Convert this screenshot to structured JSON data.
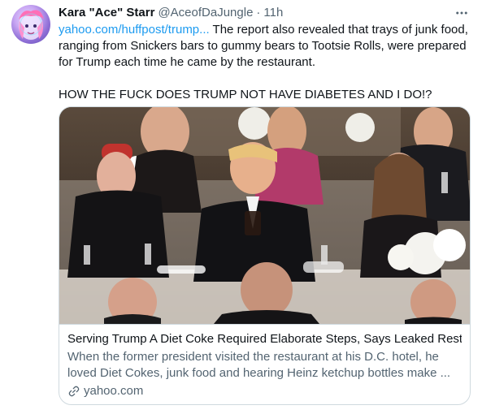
{
  "tweet": {
    "display_name": "Kara \"Ace\" Starr",
    "handle": "@AceofDaJungle",
    "separator": "·",
    "time": "11h",
    "link_text": "yahoo.com/huffpost/trump...",
    "text_after_link": " The report also revealed that trays of junk food, ranging from Snickers bars to gummy bears to Tootsie Rolls, were prepared for Trump each time he came by the restaurant.",
    "second_paragraph": "HOW THE FUCK DOES TRUMP NOT HAVE DIABETES AND I DO!?"
  },
  "icons": {
    "more": "more-horizontal-icon",
    "link": "link-icon"
  },
  "card": {
    "title": "Serving Trump A Diet Coke Required Elaborate Steps, Says Leaked Resta...",
    "description": "When the former president visited the restaurant at his D.C. hotel, he loved Diet Cokes, junk food and hearing Heinz ketchup bottles make ...",
    "source": "yahoo.com"
  },
  "colors": {
    "link": "#1d9bf0",
    "secondary_text": "#536471",
    "border": "#cfd9de"
  }
}
